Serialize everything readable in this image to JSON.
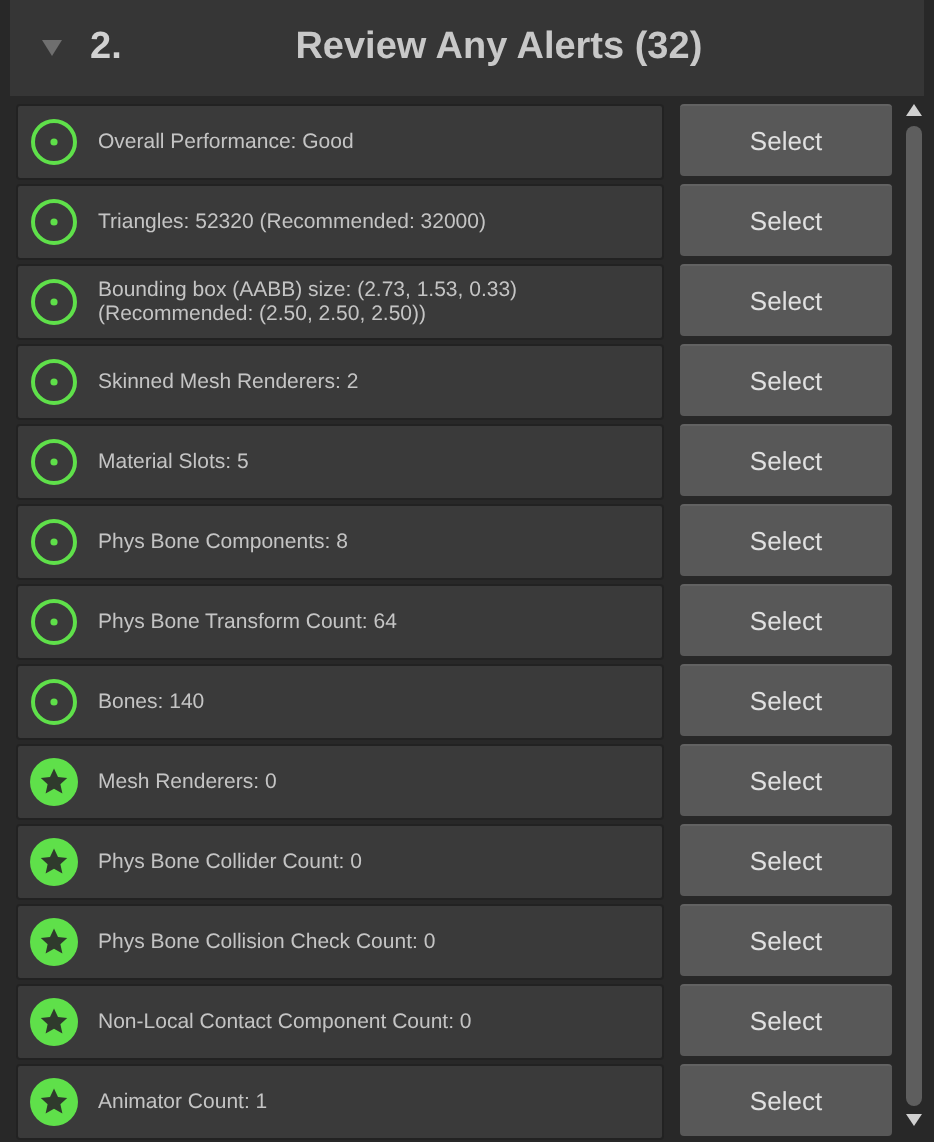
{
  "section": {
    "expanded": true,
    "number": "2.",
    "title": "Review Any Alerts (32)"
  },
  "alerts": [
    {
      "kind": "good",
      "text": "Overall Performance: Good",
      "button": "Select"
    },
    {
      "kind": "good",
      "text": "Triangles: 52320 (Recommended: 32000)",
      "button": "Select"
    },
    {
      "kind": "good",
      "text": "Bounding box (AABB) size: (2.73, 1.53, 0.33)\n(Recommended: (2.50, 2.50, 2.50))",
      "button": "Select"
    },
    {
      "kind": "good",
      "text": "Skinned Mesh Renderers: 2",
      "button": "Select"
    },
    {
      "kind": "good",
      "text": "Material Slots: 5",
      "button": "Select"
    },
    {
      "kind": "good",
      "text": "Phys Bone Components: 8",
      "button": "Select"
    },
    {
      "kind": "good",
      "text": "Phys Bone Transform Count: 64",
      "button": "Select"
    },
    {
      "kind": "good",
      "text": "Bones: 140",
      "button": "Select"
    },
    {
      "kind": "excellent",
      "text": "Mesh Renderers: 0",
      "button": "Select"
    },
    {
      "kind": "excellent",
      "text": "Phys Bone Collider Count: 0",
      "button": "Select"
    },
    {
      "kind": "excellent",
      "text": "Phys Bone Collision Check Count: 0",
      "button": "Select"
    },
    {
      "kind": "excellent",
      "text": "Non-Local Contact Component Count: 0",
      "button": "Select"
    },
    {
      "kind": "excellent",
      "text": "Animator Count: 1",
      "button": "Select"
    }
  ]
}
